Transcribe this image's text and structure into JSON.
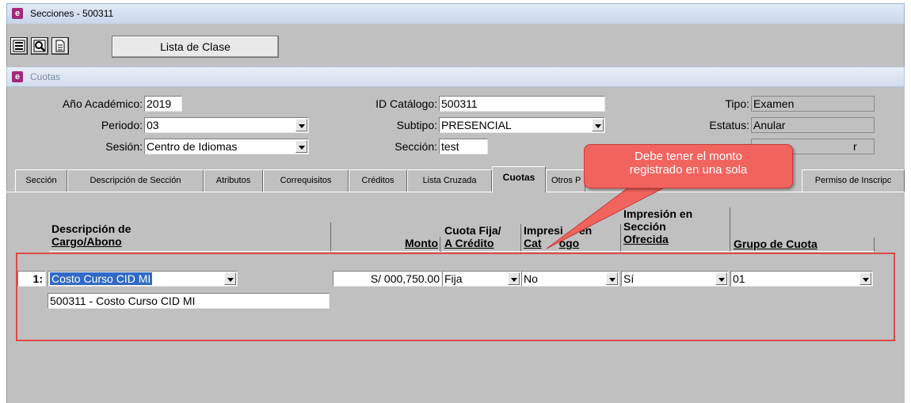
{
  "window": {
    "title": "Secciones - 500311"
  },
  "toolbar": {
    "lista_label": "Lista de Clase"
  },
  "subwindow": {
    "title": "Cuotas"
  },
  "form": {
    "anio_label": "Año Académico:",
    "anio_value": "2019",
    "periodo_label": "Periodo:",
    "periodo_value": "03",
    "sesion_label": "Sesión:",
    "sesion_value": "Centro de Idiomas",
    "catalogo_label": "ID Catálogo:",
    "catalogo_value": "500311",
    "subtipo_label": "Subtipo:",
    "subtipo_value": "PRESENCIAL",
    "seccion_label": "Sección:",
    "seccion_value": "test",
    "tipo_label": "Tipo:",
    "tipo_value": "Examen",
    "estatus_label": "Estatus:",
    "estatus_value": "Anular",
    "row3_value": "r"
  },
  "tabs": [
    "Sección",
    "Descripción de Sección",
    "Atributos",
    "Correquisitos",
    "Créditos",
    "Lista Cruzada",
    "Cuotas",
    "Otros P",
    "Permiso de Inscripc"
  ],
  "active_tab": "Cuotas",
  "grid": {
    "headers": {
      "descripcion_1": "Descripción de",
      "descripcion_2": "Cargo/Abono",
      "monto": "Monto",
      "cuota_1": "Cuota Fija/",
      "cuota_2": "A Crédito",
      "impresion_cat_1": "Impresi",
      "impresion_cat_1b": "en",
      "impresion_cat_2": "Cat",
      "impresion_cat_2b": "ogo",
      "impresion_sec_1": "Impresión en",
      "impresion_sec_2": "Sección",
      "impresion_sec_3": "Ofrecida",
      "grupo": "Grupo de Cuota"
    },
    "row": {
      "num": "1:",
      "descripcion": "Costo Curso CID MI",
      "detalle": "500311 - Costo Curso CID MI",
      "monto": "S/ 000,750.00",
      "cuota": "Fija",
      "impresion_catalogo": "No",
      "impresion_seccion": "Sí",
      "grupo": "01"
    }
  },
  "callout": {
    "line1": "Debe tener el monto",
    "line2": "registrado en una sola"
  },
  "colors": {
    "annotation_red": "#e24747",
    "callout_fill": "#f1645e",
    "form_gray": "#c0c0c0",
    "app_icon": "#a3287a"
  }
}
